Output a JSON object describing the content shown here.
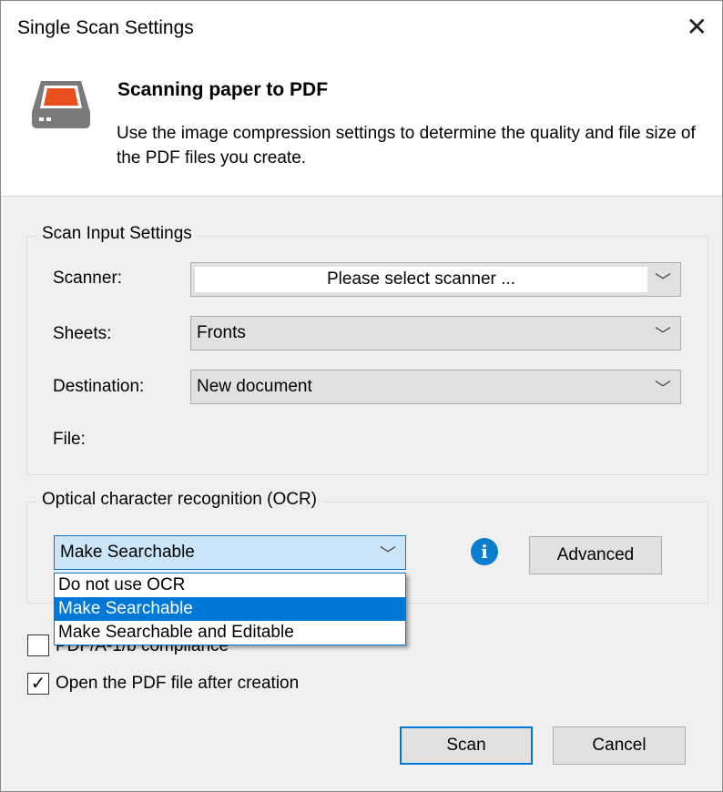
{
  "window": {
    "title": "Single Scan Settings",
    "close_icon": "close-icon"
  },
  "header": {
    "title": "Scanning paper to PDF",
    "description": "Use the image compression settings to determine the quality and file size of the PDF files you create.",
    "icon": "scanner-icon",
    "accent": "#e8501e"
  },
  "scan_input": {
    "legend": "Scan Input Settings",
    "scanner_label": "Scanner:",
    "scanner_value": "Please select scanner ...",
    "sheets_label": "Sheets:",
    "sheets_value": "Fronts",
    "destination_label": "Destination:",
    "destination_value": "New document",
    "file_label": "File:"
  },
  "ocr": {
    "legend": "Optical character recognition (OCR)",
    "selected": "Make Searchable",
    "options": [
      "Do not use OCR",
      "Make Searchable",
      "Make Searchable and Editable"
    ],
    "advanced_label": "Advanced",
    "info_icon": "i"
  },
  "options": {
    "pdfa_label": "PDF/A-1/b compliance",
    "pdfa_checked": false,
    "open_label": "Open the PDF file after creation",
    "open_checked": true
  },
  "buttons": {
    "scan": "Scan",
    "cancel": "Cancel"
  }
}
